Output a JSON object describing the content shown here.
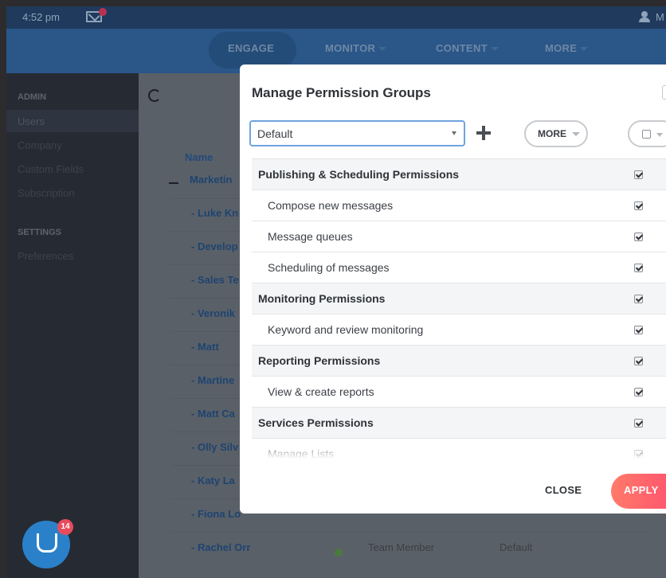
{
  "topbar": {
    "time": "4:52 pm",
    "user_initial": "M"
  },
  "nav": {
    "items": [
      "ENGAGE",
      "MONITOR",
      "CONTENT",
      "MORE"
    ]
  },
  "sidebar": {
    "admin_header": "ADMIN",
    "admin_items": [
      "Users",
      "Company",
      "Custom Fields",
      "Subscription"
    ],
    "settings_header": "SETTINGS",
    "settings_items": [
      "Preferences"
    ]
  },
  "table": {
    "name_header": "Name",
    "group_row": "Marketin",
    "rows": [
      "- Luke Kn",
      "- Develop",
      "- Sales Te",
      "- Veronik",
      "- Matt",
      "- Martine",
      "- Matt Ca",
      "- Olly Silv",
      "- Katy La",
      "- Fiona Lo",
      "- Rachel Orr"
    ],
    "last_row_role": "Team Member",
    "last_row_group": "Default"
  },
  "chat": {
    "badge": "14"
  },
  "modal": {
    "title": "Manage Permission Groups",
    "group_value": "Default",
    "more_label": "MORE",
    "close_label": "CLOSE",
    "apply_label": "APPLY",
    "permissions": [
      {
        "label": "Publishing & Scheduling Permissions",
        "type": "cat",
        "checked": true
      },
      {
        "label": "Compose new messages",
        "type": "item",
        "checked": true
      },
      {
        "label": "Message queues",
        "type": "item",
        "checked": true
      },
      {
        "label": "Scheduling of messages",
        "type": "item",
        "checked": true
      },
      {
        "label": "Monitoring Permissions",
        "type": "cat",
        "checked": true
      },
      {
        "label": "Keyword and review monitoring",
        "type": "item",
        "checked": true
      },
      {
        "label": "Reporting Permissions",
        "type": "cat",
        "checked": true
      },
      {
        "label": "View & create reports",
        "type": "item",
        "checked": true
      },
      {
        "label": "Services Permissions",
        "type": "cat",
        "checked": true
      },
      {
        "label": "Manage Lists",
        "type": "item",
        "checked": true
      }
    ]
  }
}
